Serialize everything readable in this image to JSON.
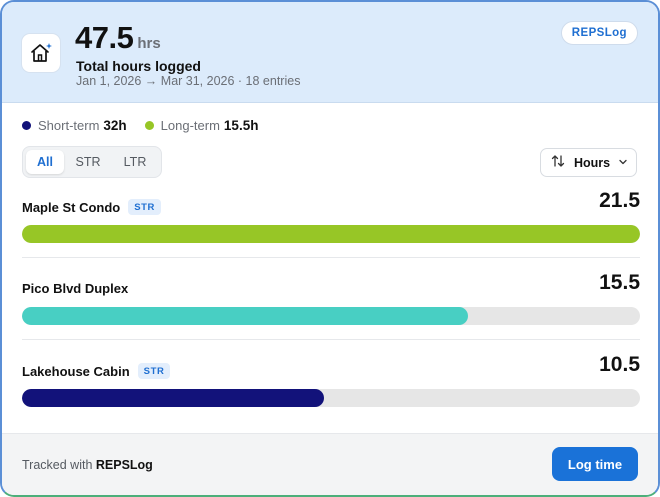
{
  "header": {
    "total_value": "47.5",
    "total_unit": "hrs",
    "title": "Total hours logged",
    "subtitle": "Jan 1, 2026 → Mar 31, 2026 · 18 entries",
    "brand_badge": "REPSLog",
    "icon": "home-sparkle-icon"
  },
  "legend": [
    {
      "label": "Short-term",
      "value": "32h",
      "color": "#12127a"
    },
    {
      "label": "Long-term",
      "value": "15.5h",
      "color": "#97c626"
    }
  ],
  "filter": {
    "options": [
      "All",
      "STR",
      "LTR"
    ],
    "selected": "All"
  },
  "sort": {
    "label": "Hours",
    "icon": "sort-arrows-icon",
    "chevron": "chevron-down-icon"
  },
  "properties": [
    {
      "name": "Maple St Condo",
      "tag": "STR",
      "hours_label": "21.5",
      "hours": 21.5,
      "color": "#97c626"
    },
    {
      "name": "Pico Blvd Duplex",
      "tag": "",
      "hours_label": "15.5",
      "hours": 15.5,
      "color": "#48cfc3"
    },
    {
      "name": "Lakehouse Cabin",
      "tag": "STR",
      "hours_label": "10.5",
      "hours": 10.5,
      "color": "#12127a"
    }
  ],
  "bar_max": 21.5,
  "footer": {
    "prefix": "Tracked with ",
    "brand": "REPSLog",
    "button": "Log time"
  },
  "colors": {
    "accent": "#1a72d8",
    "header_bg": "#dcebfb"
  }
}
